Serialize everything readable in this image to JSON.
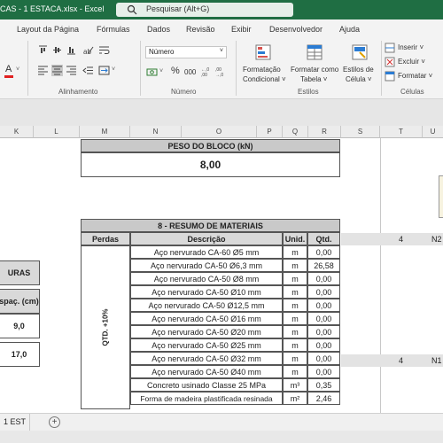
{
  "titlebar": {
    "document": "CAS - 1 ESTACA.xlsx  -  Excel",
    "search_placeholder": "Pesquisar (Alt+G)",
    "bg": "#1f6e43"
  },
  "menu": [
    "Layout da Página",
    "Fórmulas",
    "Dados",
    "Revisão",
    "Exibir",
    "Desenvolvedor",
    "Ajuda"
  ],
  "ribbon": {
    "alignment_group": "Alinhamento",
    "number_group": "Número",
    "number_format": "Número",
    "percent": "%",
    "thousands": "000",
    "styles_group": "Estilos",
    "cond_format": [
      "Formatação",
      "Condicional ˅"
    ],
    "format_table": [
      "Formatar como",
      "Tabela ˅"
    ],
    "cell_styles": [
      "Estilos de",
      "Célula ˅"
    ],
    "cells_group": "Células",
    "insert": "Inserir ˅",
    "delete": "Excluir ˅",
    "format": "Formatar ˅",
    "font_color_letter": "A"
  },
  "columns": [
    "K",
    "L",
    "M",
    "N",
    "O",
    "P",
    "Q",
    "R",
    "S",
    "T",
    "U"
  ],
  "peso": {
    "title": "PESO DO BLOCO (kN)",
    "value": "8,00"
  },
  "left_table": {
    "label_header": "URAS",
    "spacing_header": "spaç. (cm)",
    "values": [
      "9,0",
      "17,0"
    ]
  },
  "resumo": {
    "title": "8 - RESUMO DE MATERIAIS",
    "headers": {
      "perdas": "Perdas",
      "descricao": "Descrição",
      "unid": "Unid.",
      "qtd": "Qtd."
    },
    "perdas_label": "QTD. +10%",
    "rows": [
      {
        "desc": "Aço nervurado CA-60 Ø5 mm",
        "unit": "m",
        "qty": "0,00"
      },
      {
        "desc": "Aço nervurado CA-50 Ø6,3 mm",
        "unit": "m",
        "qty": "26,58"
      },
      {
        "desc": "Aço nervurado CA-50 Ø8 mm",
        "unit": "m",
        "qty": "0,00"
      },
      {
        "desc": "Aço nervurado CA-50 Ø10 mm",
        "unit": "m",
        "qty": "0,00"
      },
      {
        "desc": "Aço nervurado CA-50 Ø12,5 mm",
        "unit": "m",
        "qty": "0,00"
      },
      {
        "desc": "Aço nervurado CA-50 Ø16 mm",
        "unit": "m",
        "qty": "0,00"
      },
      {
        "desc": "Aço nervurado CA-50 Ø20 mm",
        "unit": "m",
        "qty": "0,00"
      },
      {
        "desc": "Aço nervurado CA-50 Ø25 mm",
        "unit": "m",
        "qty": "0,00"
      },
      {
        "desc": "Aço nervurado CA-50 Ø32 mm",
        "unit": "m",
        "qty": "0,00"
      },
      {
        "desc": "Aço nervurado CA-50 Ø40 mm",
        "unit": "m",
        "qty": "0,00"
      },
      {
        "desc": "Concreto usinado Classe  25 MPa",
        "unit": "m³",
        "qty": "0,35"
      },
      {
        "desc": "Forma de madeira plastificada resinada",
        "unit": "m²",
        "qty": "2,46"
      }
    ]
  },
  "right_cells": {
    "row1": [
      "4",
      "N2"
    ],
    "row2": [
      "4",
      "N1"
    ]
  },
  "tabs": {
    "sheet": "1 EST",
    "add": "+"
  }
}
